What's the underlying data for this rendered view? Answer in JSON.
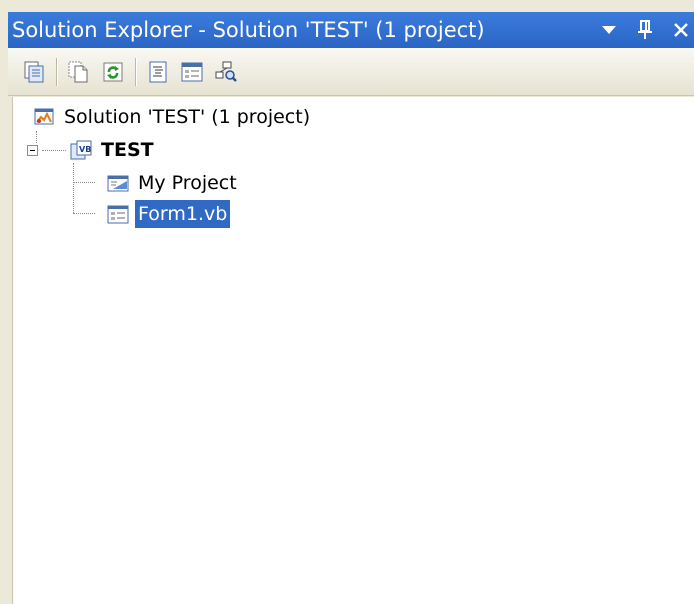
{
  "window": {
    "title": "Solution Explorer - Solution 'TEST' (1 project)",
    "controls": {
      "dropdown_glyph": "▼",
      "pin_glyph": "ᛘ",
      "close_glyph": "✕"
    }
  },
  "toolbar": {
    "buttons": [
      {
        "icon": "properties-icon"
      },
      {
        "icon": "show-all-files-icon"
      },
      {
        "icon": "refresh-icon"
      },
      {
        "icon": "view-code-icon"
      },
      {
        "icon": "view-designer-icon"
      },
      {
        "icon": "class-diagram-icon"
      }
    ]
  },
  "tree": {
    "solution": {
      "label": "Solution 'TEST' (1 project)",
      "icon": "solution-icon"
    },
    "project": {
      "label": "TEST",
      "icon": "vb-project-icon",
      "expanded": true
    },
    "children": [
      {
        "label": "My Project",
        "icon": "my-project-icon",
        "selected": false
      },
      {
        "label": "Form1.vb",
        "icon": "form-icon",
        "selected": true
      }
    ]
  },
  "colors": {
    "titlebar": "#2b65c4",
    "selection": "#316ac5",
    "chrome": "#ece9d8"
  }
}
